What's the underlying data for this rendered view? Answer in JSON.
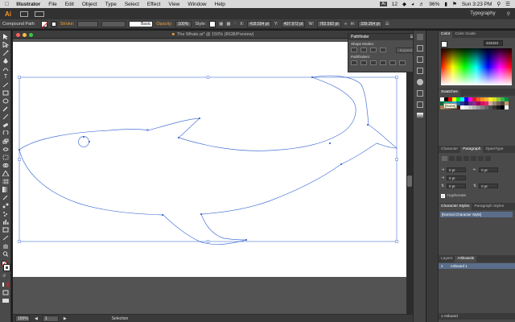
{
  "menubar": {
    "app_name": "Illustrator",
    "items": [
      "File",
      "Edit",
      "Object",
      "Type",
      "Select",
      "Effect",
      "View",
      "Window",
      "Help"
    ],
    "status": {
      "ai_badge": "12",
      "battery": "96%",
      "clock": "Sun 3:23 PM"
    }
  },
  "appbar": {
    "logo": "Ai",
    "workspace": "Typography"
  },
  "controlbar": {
    "selection_type": "Compound Path",
    "stroke_label": "Stroke:",
    "stroke_weight": "",
    "brush_label": "Basic",
    "opacity_label": "Opacity:",
    "opacity_value": "100%",
    "style_label": "Style:",
    "x_label": "X:",
    "x_value": "418.594 pt",
    "y_label": "Y:",
    "y_value": "407.972 pt",
    "w_label": "W:",
    "w_value": "782.592 pt",
    "h_label": "H:",
    "h_value": "339.354 pt"
  },
  "document": {
    "title": "The Whale.ai* @ 150% (RGB/Preview)"
  },
  "pathfinder": {
    "title": "Pathfinder",
    "shape_modes_label": "Shape Modes:",
    "pathfinders_label": "Pathfinders:",
    "expand_label": "Expand"
  },
  "color_panel": {
    "tabs": [
      "Color",
      "Color Guide"
    ],
    "hex_value": "333333"
  },
  "swatches": {
    "title": "Swatches",
    "tooltip": "[None]",
    "colors": [
      "#ffffff",
      "#000000",
      "#ff0000",
      "#ffff00",
      "#00ff00",
      "#00ffff",
      "#0000ff",
      "#ff00ff",
      "#d81e2b",
      "#f15a24",
      "#f7931e",
      "#fbb03b",
      "#fcee21",
      "#d9e021",
      "#8cc63f",
      "#39b54a",
      "#009245",
      "#006837",
      "#22b573",
      "#00a99d",
      "#29abe2",
      "#0071bc",
      "#2e3192",
      "#1b1464",
      "#662d91",
      "#93278f",
      "#9e005d",
      "#d4145a",
      "#ed1e79",
      "#c7b299",
      "#998675",
      "#736357",
      "#534741",
      "#c69c6d",
      "#a67c52",
      "#8c6239",
      "#754c24",
      "#603813",
      "#42210b",
      "#ffffff",
      "#e6e6e6",
      "#cccccc",
      "#b3b3b3",
      "#999999",
      "#808080",
      "#666666",
      "#4d4d4d",
      "#333333",
      "#1a1a1a",
      "#000000",
      "#f2f2f2"
    ]
  },
  "paragraph_panel": {
    "tabs": [
      "Character",
      "Paragraph",
      "OpenType"
    ],
    "fields": [
      "0 pt",
      "0 pt",
      "0 pt",
      "0 pt",
      "0 pt"
    ],
    "hyphenate_label": "Hyphenate"
  },
  "char_styles_panel": {
    "tabs": [
      "Character Styles",
      "Paragraph Styles"
    ],
    "items": [
      "[Normal Character Style]"
    ]
  },
  "layers_panel": {
    "tabs": [
      "Layers",
      "Artboards"
    ],
    "rows": [
      {
        "index": "1",
        "name": "Artboard 1"
      }
    ],
    "footer": "1 Artboard"
  },
  "statusbar": {
    "zoom": "150%",
    "artboard_num": "1",
    "tool": "Selection"
  },
  "colors": {
    "path_stroke": "#4a74d6",
    "ui_bg": "#4a4a4a",
    "accent_orange": "#e8a33c"
  }
}
